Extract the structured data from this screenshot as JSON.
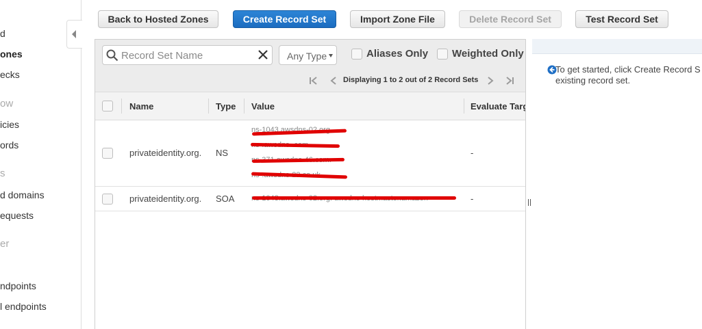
{
  "sidenav": {
    "items": [
      {
        "label": "d"
      },
      {
        "label": "ones"
      },
      {
        "label": "ecks"
      },
      {
        "label": "ow"
      },
      {
        "label": "icies"
      },
      {
        "label": "ords"
      },
      {
        "label": "s"
      },
      {
        "label": "d domains"
      },
      {
        "label": "equests"
      },
      {
        "label": "er"
      },
      {
        "label": "ndpoints"
      },
      {
        "label": "l endpoints"
      }
    ]
  },
  "toolbar": {
    "back_label": "Back to Hosted Zones",
    "create_label": "Create Record Set",
    "import_label": "Import Zone File",
    "delete_label": "Delete Record Set",
    "test_label": "Test Record Set"
  },
  "filters": {
    "search_placeholder": "Record Set Name",
    "search_value": "",
    "type_selected": "Any Type",
    "aliases_label": "Aliases Only",
    "weighted_label": "Weighted Only"
  },
  "pager": {
    "text": "Displaying 1 to 2 out of 2 Record Sets"
  },
  "table": {
    "columns": {
      "name": "Name",
      "type": "Type",
      "value": "Value",
      "evaluate": "Evaluate Targ"
    },
    "rows": [
      {
        "name": "privateidentity.org.",
        "type": "NS",
        "values": [
          "ns-1043.awsdns-02.org.",
          "ns-.awsdns-.com.",
          "ns-371.awsdns-46.com.",
          "ns-.awsdns-22.co.uk."
        ],
        "evaluate": "-"
      },
      {
        "name": "privateidentity.org.",
        "type": "SOA",
        "values": [
          "ns-1043.awsdns-02.org. awsdns-hostmaster.amazon"
        ],
        "evaluate": "-"
      }
    ]
  },
  "right_panel": {
    "help_line1": "To get started, click Create Record S",
    "help_line2": "existing record set."
  },
  "colors": {
    "primary": "#1b6cc0",
    "redaction": "#e00000"
  }
}
